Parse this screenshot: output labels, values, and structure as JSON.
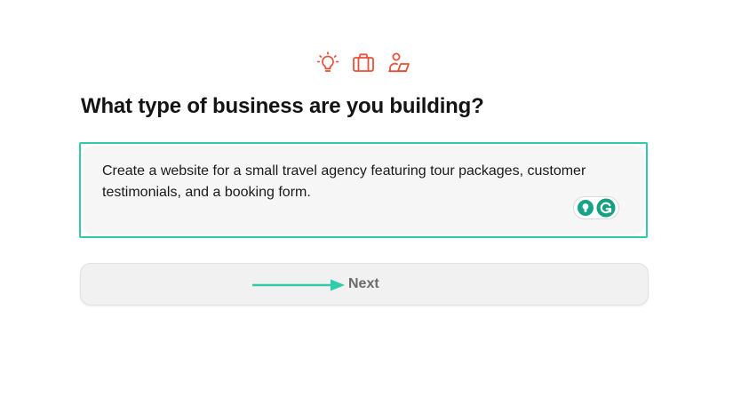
{
  "icons": [
    {
      "name": "lightbulb-icon",
      "color": "#e5533d"
    },
    {
      "name": "briefcase-icon",
      "color": "#e5533d"
    },
    {
      "name": "person-laptop-icon",
      "color": "#e5533d"
    }
  ],
  "question": {
    "title": "What type of business are you building?"
  },
  "prompt": {
    "value": "Create a website for a small travel agency featuring tour packages, customer testimonials, and a booking form.",
    "highlight_color": "#2ecca8"
  },
  "assistant_icons": [
    {
      "name": "lightbulb-assist-icon",
      "color": "#17a388"
    },
    {
      "name": "grammarly-icon",
      "color": "#15a080"
    }
  ],
  "next_button": {
    "label": "Next",
    "arrow_color": "#2ecca8"
  }
}
